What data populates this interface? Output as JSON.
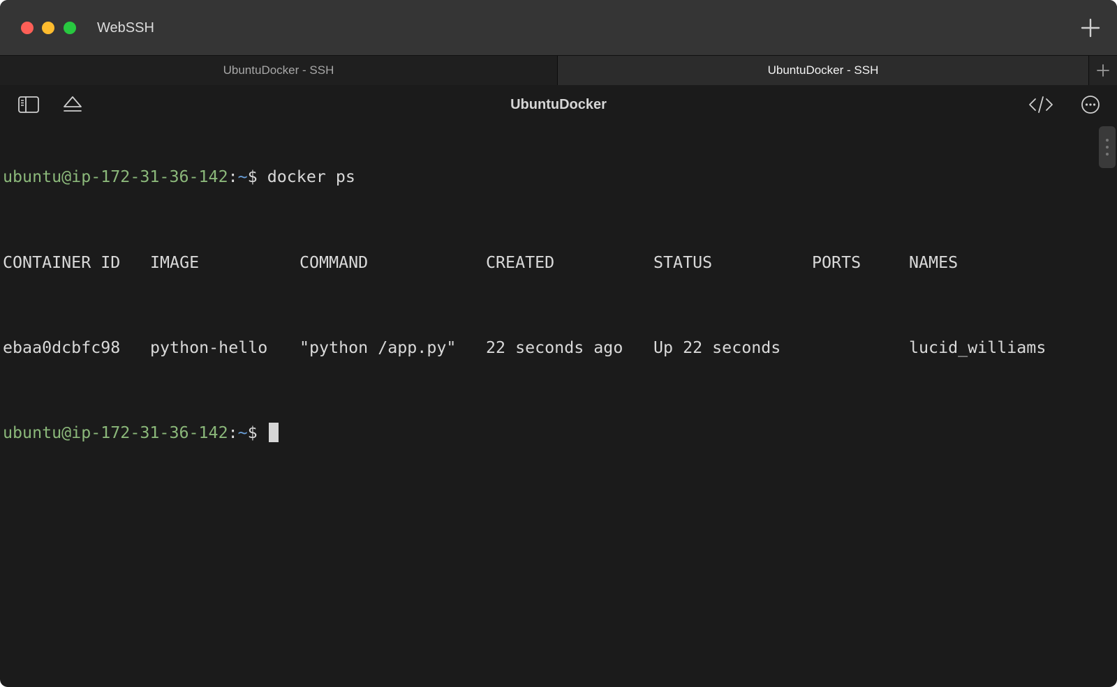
{
  "window": {
    "app_title": "WebSSH"
  },
  "tabs": [
    {
      "label": "UbuntuDocker - SSH",
      "active": false
    },
    {
      "label": "UbuntuDocker - SSH",
      "active": true
    }
  ],
  "toolbar": {
    "title": "UbuntuDocker",
    "left_icons": [
      "sidebar-icon",
      "eject-icon"
    ],
    "right_icons": [
      "code-icon",
      "more-icon"
    ]
  },
  "terminal": {
    "prompt_user": "ubuntu@ip-172-31-36-142",
    "prompt_colon": ":",
    "prompt_path": "~",
    "prompt_dollar": "$",
    "command": " docker ps",
    "headers": [
      "CONTAINER ID",
      "IMAGE",
      "COMMAND",
      "CREATED",
      "STATUS",
      "PORTS",
      "NAMES"
    ],
    "rows": [
      [
        "ebaa0dcbfc98",
        "python-hello",
        "\"python /app.py\"",
        "22 seconds ago",
        "Up 22 seconds",
        "",
        "lucid_williams"
      ]
    ]
  },
  "colors": {
    "prompt_user": "#8bb87a",
    "prompt_path": "#6a9fd8",
    "background": "#1b1b1b"
  }
}
